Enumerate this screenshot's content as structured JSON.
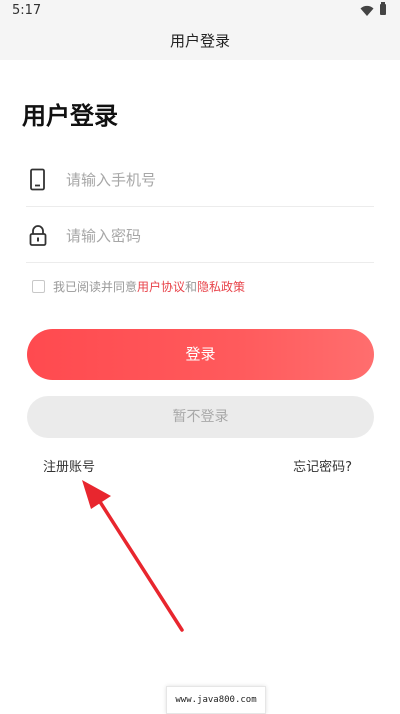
{
  "status_bar": {
    "time": "5:17",
    "icons": [
      "wifi-icon",
      "battery-icon"
    ]
  },
  "header": {
    "title": "用户登录"
  },
  "main": {
    "title": "用户登录",
    "phone_field": {
      "icon": "phone-icon",
      "placeholder": "请输入手机号",
      "value": ""
    },
    "password_field": {
      "icon": "lock-icon",
      "placeholder": "请输入密码",
      "value": ""
    },
    "agreement": {
      "checked": false,
      "prefix": "我已阅读并同意",
      "user_agreement": "用户协议",
      "conjunction": "和",
      "privacy_policy": "隐私政策"
    },
    "login_label": "登录",
    "skip_label": "暂不登录",
    "register_label": "注册账号",
    "forgot_label": "忘记密码?"
  },
  "watermark": "www.java800.com",
  "colors": {
    "accent": "#ff4a4f",
    "link": "#e8434a",
    "arrow": "#e8262e",
    "secondary_button": "#ebebeb"
  }
}
